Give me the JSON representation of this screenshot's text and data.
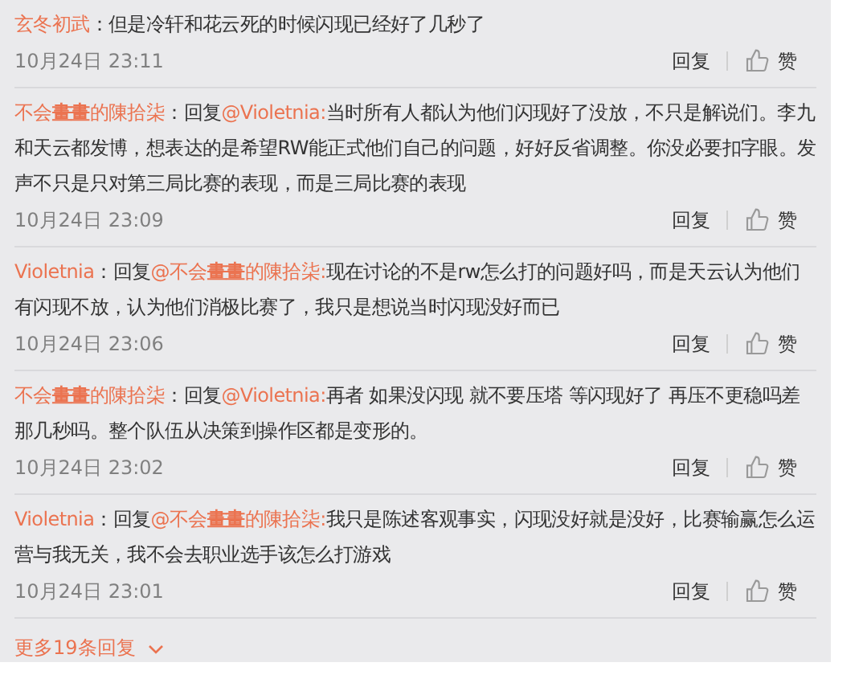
{
  "comments": [
    {
      "user": "玄冬初武",
      "separator": "：",
      "text": "但是冷轩和花云死的时候闪现已经好了几秒了",
      "time": "10月24日 23:11",
      "reply": "回复",
      "like": "赞"
    },
    {
      "user": "不会**畫畫**的陳拾柒",
      "separator": "：",
      "reply_prefix": "回复",
      "mention": "@Violetnia:",
      "text": "当时所有人都认为他们闪现好了没放，不只是解说们。李九和天云都发博，想表达的是希望RW能正式他们自己的问题，好好反省调整。你没必要扣字眼。发声不只是只对第三局比赛的表现，而是三局比赛的表现",
      "time": "10月24日 23:09",
      "reply": "回复",
      "like": "赞"
    },
    {
      "user": "Violetnia",
      "separator": "：",
      "reply_prefix": "回复",
      "mention": "@不会**畫畫**的陳拾柒:",
      "text": "现在讨论的不是rw怎么打的问题好吗，而是天云认为他们有闪现不放，认为他们消极比赛了，我只是想说当时闪现没好而已",
      "time": "10月24日 23:06",
      "reply": "回复",
      "like": "赞"
    },
    {
      "user": "不会**畫畫**的陳拾柒",
      "separator": "：",
      "reply_prefix": "回复",
      "mention": "@Violetnia:",
      "text": "再者 如果没闪现 就不要压塔 等闪现好了 再压不更稳吗差那几秒吗。整个队伍从决策到操作区都是变形的。",
      "time": "10月24日 23:02",
      "reply": "回复",
      "like": "赞"
    },
    {
      "user": "Violetnia",
      "separator": "：",
      "reply_prefix": "回复",
      "mention": "@不会**畫畫**的陳拾柒:",
      "text": "我只是陈述客观事实，闪现没好就是没好，比赛输赢怎么运营与我无关，我不会去职业选手该怎么打游戏",
      "time": "10月24日 23:01",
      "reply": "回复",
      "like": "赞"
    }
  ],
  "more": {
    "label": "更多19条回复"
  }
}
